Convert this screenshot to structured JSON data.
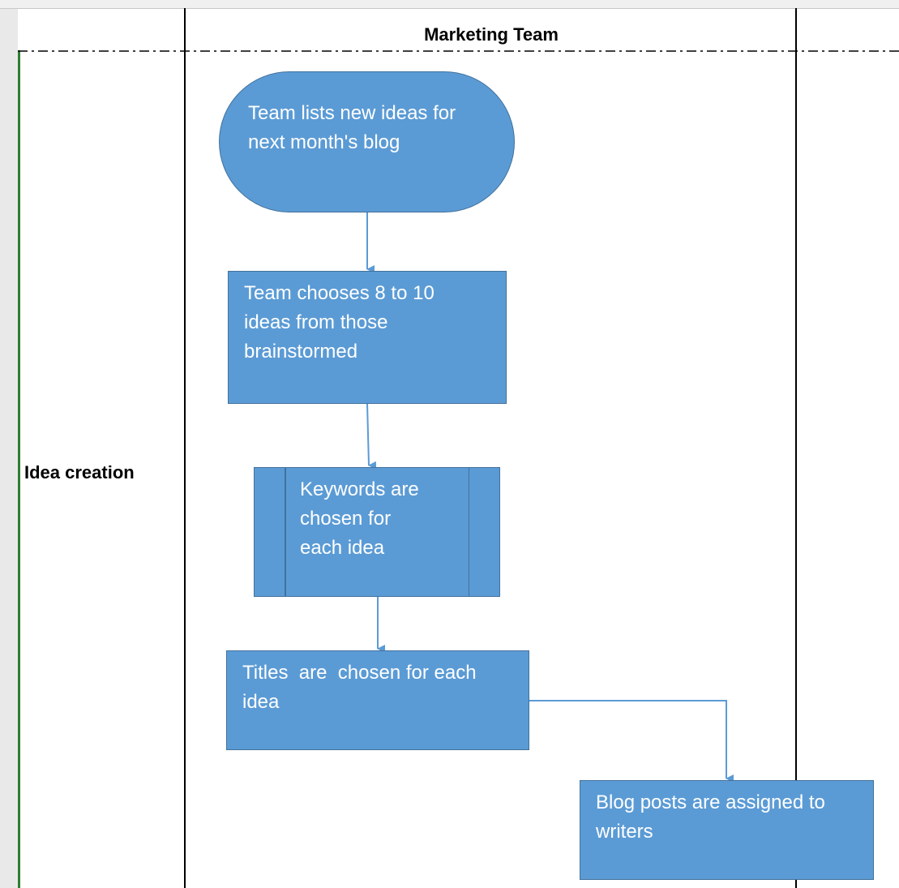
{
  "swimlane": {
    "header": "Marketing Team",
    "lane_label": "Idea creation"
  },
  "nodes": {
    "start": {
      "text": "Team lists new ideas for\nnext month's blog",
      "shape": "terminator"
    },
    "choose": {
      "text": "Team chooses 8 to 10\nideas from those\nbrainstormed",
      "shape": "process"
    },
    "keywords": {
      "text": "Keywords are\nchosen for\neach idea",
      "shape": "predefined-process"
    },
    "titles": {
      "text": "Titles  are  chosen for each\nidea",
      "shape": "process"
    },
    "assign": {
      "text": "Blog posts are assigned to\nwriters",
      "shape": "process"
    }
  },
  "edges": [
    {
      "from": "start",
      "to": "choose"
    },
    {
      "from": "choose",
      "to": "keywords"
    },
    {
      "from": "keywords",
      "to": "titles"
    },
    {
      "from": "titles",
      "to": "assign"
    }
  ],
  "colors": {
    "shape_fill": "#5b9bd5",
    "shape_border": "#41719c",
    "connector": "#5b9bd5",
    "lane_rule": "#2e7d32"
  }
}
